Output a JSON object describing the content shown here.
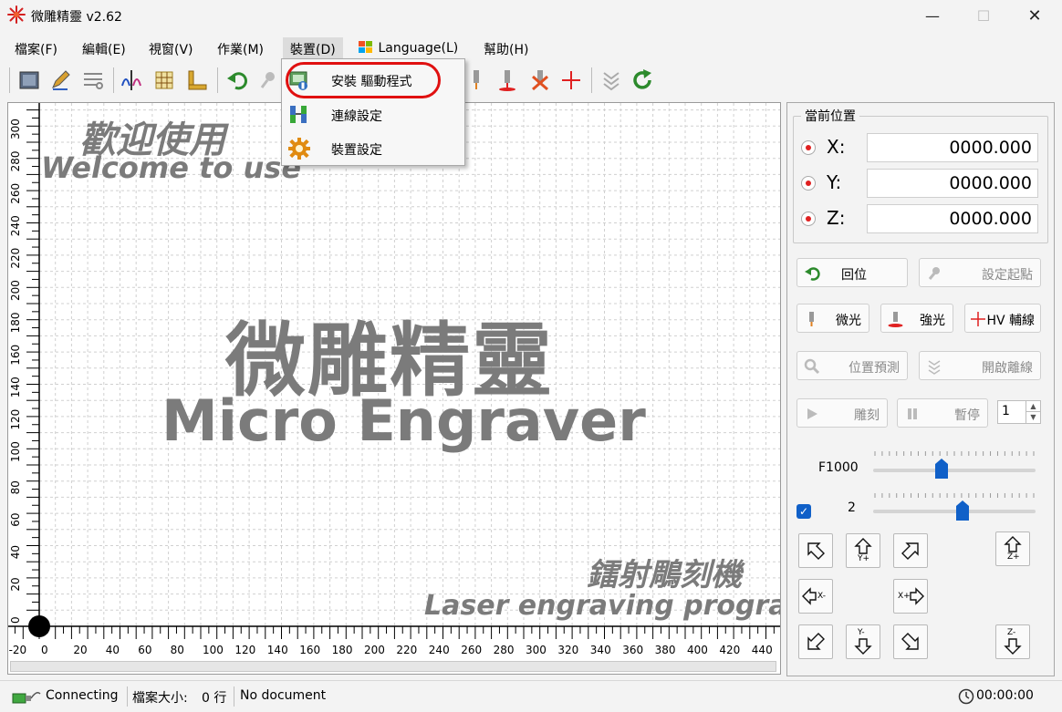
{
  "window": {
    "title": "微雕精靈 v2.62",
    "minimize": "—",
    "maximize": "☐",
    "close": "✕"
  },
  "menubar": {
    "items": [
      {
        "label": "檔案(F)"
      },
      {
        "label": "編輯(E)"
      },
      {
        "label": "視窗(V)"
      },
      {
        "label": "作業(M)"
      },
      {
        "label": "裝置(D)"
      },
      {
        "label": "Language(L)"
      },
      {
        "label": "幫助(H)"
      }
    ],
    "active_index": 4
  },
  "device_menu": {
    "items": [
      {
        "label": "安裝 驅動程式",
        "icon": "driver-install-icon",
        "highlighted": true
      },
      {
        "label": "連線設定",
        "icon": "connection-icon"
      },
      {
        "label": "裝置設定",
        "icon": "gear-icon"
      }
    ]
  },
  "canvas": {
    "watermark_welcome_zh": "歡迎使用",
    "watermark_welcome_en": "Welcome to use",
    "watermark_title_zh": "微雕精靈",
    "watermark_title_en": "Micro Engraver",
    "watermark_laser_zh": "鐳射鵰刻機",
    "watermark_laser_en": "Laser engraving program",
    "x_ticks": [
      "-20",
      "0",
      "20",
      "40",
      "60",
      "80",
      "100",
      "120",
      "140",
      "160",
      "180",
      "200",
      "220",
      "240",
      "260",
      "280",
      "300",
      "320",
      "340",
      "360",
      "380",
      "400",
      "420",
      "440"
    ],
    "y_ticks": [
      "300",
      "280",
      "260",
      "240",
      "220",
      "200",
      "180",
      "160",
      "140",
      "120",
      "100",
      "80",
      "60",
      "40",
      "20",
      "0"
    ]
  },
  "position_panel": {
    "title": "當前位置",
    "axes": [
      {
        "label": "X:",
        "value": "0000.000"
      },
      {
        "label": "Y:",
        "value": "0000.000"
      },
      {
        "label": "Z:",
        "value": "0000.000"
      }
    ]
  },
  "controls": {
    "home": "回位",
    "set_origin": "設定起點",
    "weak_light": "微光",
    "strong_light": "強光",
    "hv_crosshair": "HV 輔線",
    "preview_position": "位置預測",
    "open_offline": "開啟離線",
    "engrave": "雕刻",
    "pause": "暫停",
    "repeat_count": "1",
    "feed_label": "F1000",
    "feed_level": 0.42,
    "speed_label": "2",
    "speed_level": 0.55,
    "checkbox_checked": true
  },
  "jog": {
    "y_plus": "Y+",
    "y_minus": "Y-",
    "x_plus": "X+",
    "x_minus": "X-",
    "z_plus": "Z+",
    "z_minus": "Z-"
  },
  "statusbar": {
    "connection": "Connecting",
    "file_size_label": "檔案大小:",
    "file_size_value": "0 行",
    "document": "No document",
    "timer": "00:00:00"
  },
  "colors": {
    "accent": "#1060c8",
    "highlight": "#e01010",
    "watermark": "#7b7b7b"
  }
}
